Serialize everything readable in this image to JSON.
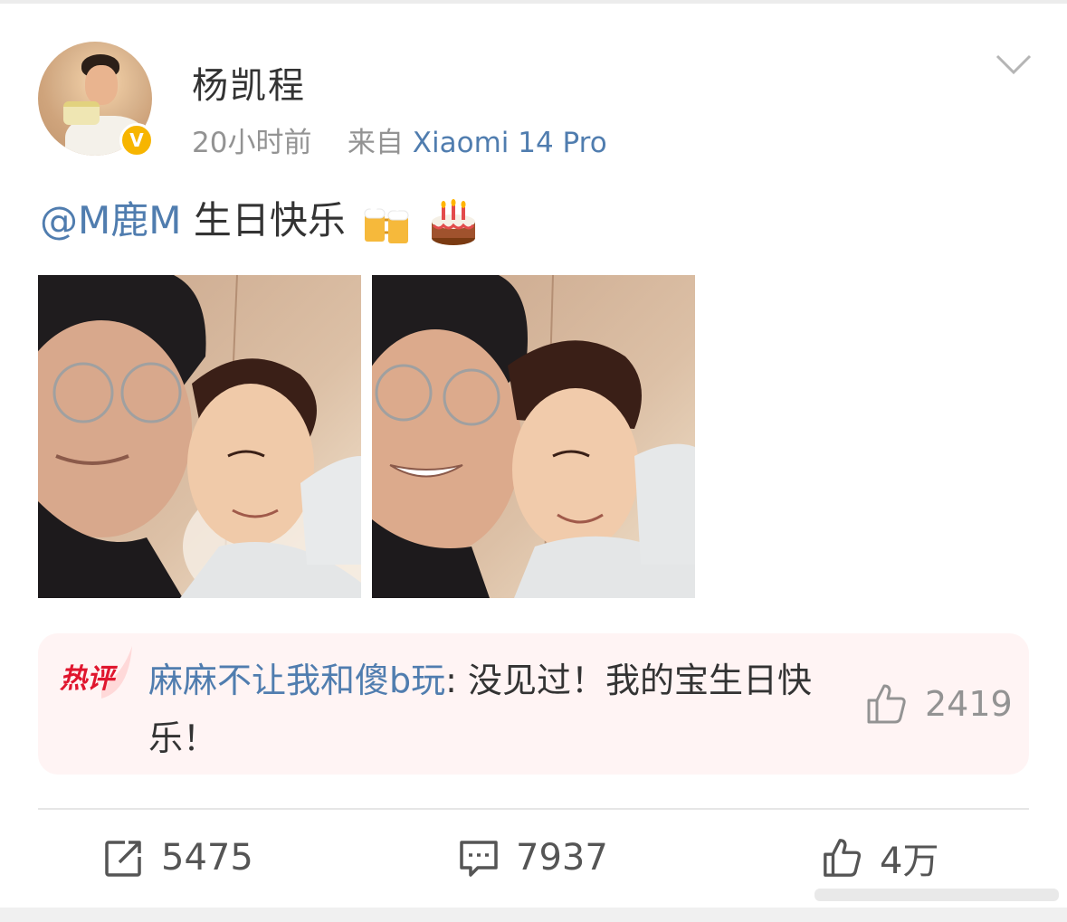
{
  "post": {
    "username": "杨凯程",
    "time": "20小时前",
    "source_prefix": "来自",
    "source_device": "Xiaomi 14 Pro",
    "mention": "@M鹿M",
    "text": " 生日快乐",
    "emojis": [
      "beer-mugs-emoji",
      "birthday-cake-emoji"
    ],
    "images": [
      "photo-1",
      "photo-2"
    ]
  },
  "hot_comment": {
    "badge": "热评",
    "user": "麻麻不让我和傻b玩",
    "separator": ":",
    "text": " 没见过！我的宝生日快乐！",
    "likes": "2419"
  },
  "actions": {
    "repost_count": "5475",
    "comment_count": "7937",
    "like_count": "4万"
  },
  "colors": {
    "link": "#507daf",
    "meta": "#939393",
    "hot_bg": "#fff4f4",
    "hot_badge": "#e0162e",
    "verified": "#f7b500"
  }
}
